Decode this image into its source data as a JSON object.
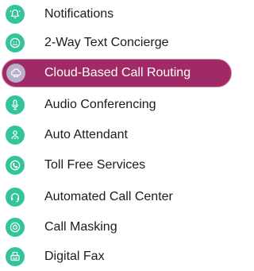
{
  "menu": {
    "items": [
      {
        "label": "Notifications",
        "icon": "bell-icon"
      },
      {
        "label": "2-Way Text Concierge",
        "icon": "chat-icon"
      },
      {
        "label": "Cloud-Based Call Routing",
        "icon": "cloud-phone-icon",
        "active": true
      },
      {
        "label": "Audio Conferencing",
        "icon": "microphone-icon"
      },
      {
        "label": "Auto Attendant",
        "icon": "phone-person-icon"
      },
      {
        "label": "Toll Free Services",
        "icon": "phone-icon"
      },
      {
        "label": "Automated Call Center",
        "icon": "headset-icon"
      },
      {
        "label": "Call Masking",
        "icon": "mask-icon"
      },
      {
        "label": "Digital Fax",
        "icon": "fax-icon"
      }
    ]
  },
  "colors": {
    "icon_bg": "#33c49c",
    "active_bg": "#a02a65",
    "active_icon_bg": "#b7b0c8",
    "text": "#1b1b1b",
    "active_text": "#ffffff"
  }
}
